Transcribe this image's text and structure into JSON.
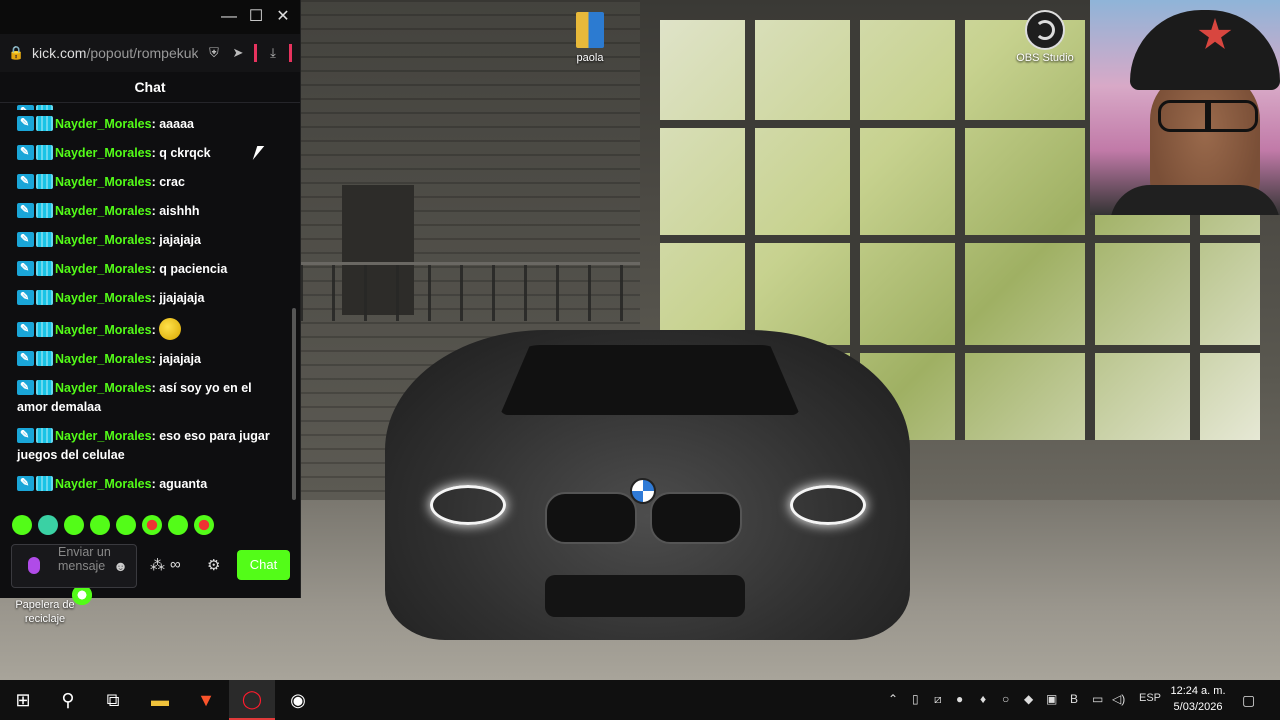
{
  "browser": {
    "url_host": "kick.com",
    "url_path": "/popout/rompekuka"
  },
  "chat": {
    "title": "Chat",
    "messages": [
      {
        "user": "Nayder_Morales",
        "text": "aaaaa"
      },
      {
        "user": "Nayder_Morales",
        "text": "q ckrqck"
      },
      {
        "user": "Nayder_Morales",
        "text": "crac"
      },
      {
        "user": "Nayder_Morales",
        "text": "aishhh"
      },
      {
        "user": "Nayder_Morales",
        "text": "jajajaja"
      },
      {
        "user": "Nayder_Morales",
        "text": "q paciencia"
      },
      {
        "user": "Nayder_Morales",
        "text": "jjajajaja"
      },
      {
        "user": "Nayder_Morales",
        "text": ""
      },
      {
        "user": "Nayder_Morales",
        "text": "jajajaja"
      },
      {
        "user": "Nayder_Morales",
        "text": "así soy yo en el amor demalaa"
      },
      {
        "user": "Nayder_Morales",
        "text": "eso eso para jugar juegos del celulae"
      },
      {
        "user": "Nayder_Morales",
        "text": "aguanta"
      }
    ],
    "input_placeholder": "Enviar un mensaje",
    "send_label": "Chat"
  },
  "desktop": {
    "folder_label": "paola",
    "obs_label": "OBS Studio",
    "recycle_label": "Papelera de reciclaje"
  },
  "taskbar": {
    "language": "ESP",
    "time": "12:24 a. m.",
    "date": "5/03/2026"
  },
  "colors": {
    "kick_green": "#53fc18",
    "accent_red": "#e03a3a"
  }
}
